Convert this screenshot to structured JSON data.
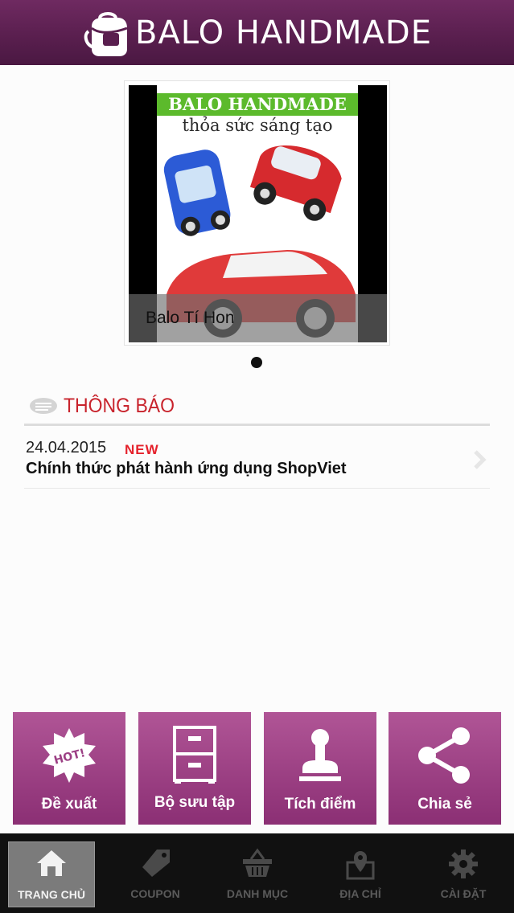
{
  "app": {
    "title": "BALO HANDMADE"
  },
  "slider": {
    "banner_title": "BALO HANDMADE",
    "banner_subtitle": "thỏa sức sáng tạo",
    "caption": "Balo Tí Hon"
  },
  "notice": {
    "heading": "THÔNG BÁO",
    "items": [
      {
        "date": "24.04.2015",
        "badge": "NEW",
        "text": "Chính thức phát hành ứng dụng ShopViet"
      }
    ]
  },
  "tiles": [
    {
      "label": "Đề xuất",
      "icon": "hot-badge-icon",
      "badge": "HOT!"
    },
    {
      "label": "Bộ sưu tập",
      "icon": "cabinet-icon"
    },
    {
      "label": "Tích điểm",
      "icon": "stamp-icon"
    },
    {
      "label": "Chia sẻ",
      "icon": "share-icon"
    }
  ],
  "tabbar": [
    {
      "label": "TRANG CHỦ",
      "icon": "home-icon",
      "active": true
    },
    {
      "label": "COUPON",
      "icon": "tag-icon"
    },
    {
      "label": "DANH MỤC",
      "icon": "basket-icon"
    },
    {
      "label": "ĐỊA CHỈ",
      "icon": "map-pin-icon"
    },
    {
      "label": "CÀI ĐẶT",
      "icon": "gear-icon"
    }
  ],
  "colors": {
    "header": "#5a1f4f",
    "tile": "#9c3f84",
    "accent_red": "#c8232c",
    "banner_green": "#5cba2c"
  }
}
